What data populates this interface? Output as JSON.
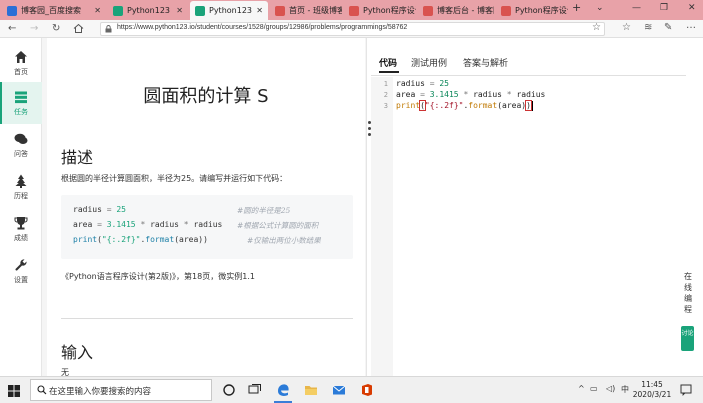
{
  "browser": {
    "tabs": [
      {
        "label": "博客园_百度搜索",
        "color": "#2b6fd6"
      },
      {
        "label": "Python123",
        "color": "#1aa37a"
      },
      {
        "label": "Python123",
        "color": "#1aa37a",
        "active": true
      },
      {
        "label": "首页 - 班级博客",
        "color": "#d9534f"
      },
      {
        "label": "Python程序设计",
        "color": "#d9534f"
      },
      {
        "label": "博客后台 - 博客园",
        "color": "#d9534f"
      },
      {
        "label": "Python程序设计",
        "color": "#d9534f"
      }
    ],
    "new_tab_label": "+",
    "url": "https://www.python123.io/student/courses/1528/groups/12986/problems/programmings/58762"
  },
  "sidebar": {
    "items": [
      {
        "label": "首页",
        "icon": "home-icon"
      },
      {
        "label": "任务",
        "icon": "task-icon",
        "active": true
      },
      {
        "label": "问答",
        "icon": "chat-icon"
      },
      {
        "label": "历程",
        "icon": "history-icon"
      },
      {
        "label": "成绩",
        "icon": "trophy-icon"
      },
      {
        "label": "设置",
        "icon": "wrench-icon"
      }
    ]
  },
  "problem": {
    "title": "圆面积的计算 S",
    "desc_heading": "描述",
    "desc_text": "根据圆的半径计算圆面积，半径为25。请编写并运行如下代码：",
    "code_comments": [
      "#圆的半径是25",
      "#根据公式计算圆的面积",
      "#仅输出两位小数结果"
    ],
    "source": "《Python语言程序设计(第2版)》，第18页，微实例1.1",
    "input_heading": "输入",
    "input_value": "无"
  },
  "editor": {
    "tabs": [
      "代码",
      "测试用例",
      "答案与解析"
    ],
    "line_numbers": [
      "1",
      "2",
      "3"
    ]
  },
  "side_buttons": {
    "online_editor": "在线编程",
    "feedback": "讨论"
  },
  "taskbar": {
    "search_placeholder": "在这里输入你要搜索的内容",
    "ime": "中",
    "time": "11:45",
    "date": "2020/3/21"
  }
}
